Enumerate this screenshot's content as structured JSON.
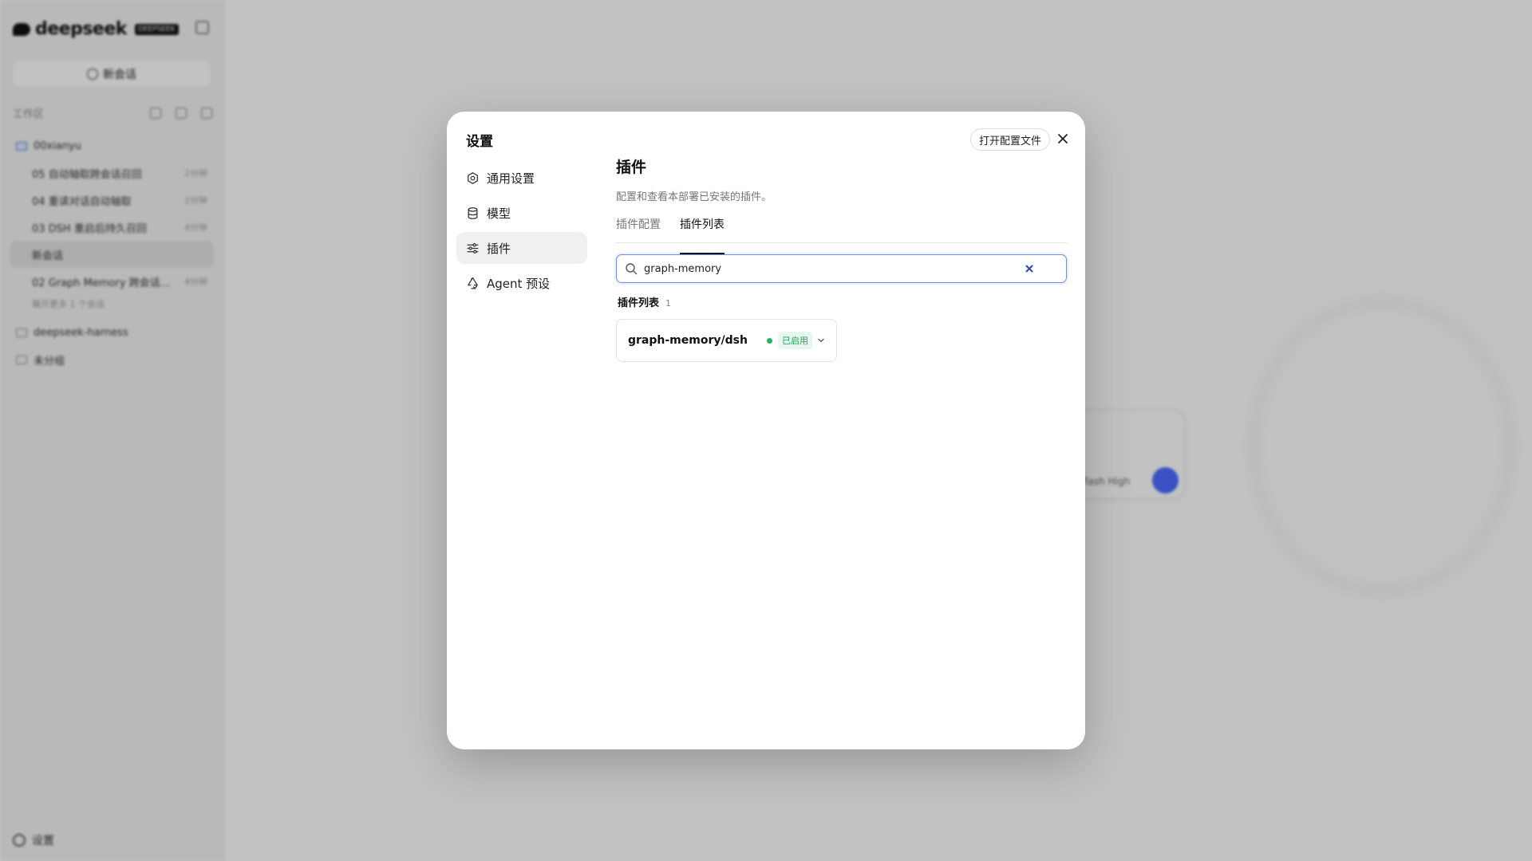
{
  "app": {
    "brand": "deepseek",
    "brand_badge": "DEEPSEEK",
    "new_chat_label": "新会话",
    "workspace_label": "工作区",
    "project": "00xianyu",
    "chats": [
      {
        "title": "05 自动轴取跨会话召回",
        "time": "2分钟"
      },
      {
        "title": "04 重读对话自动轴取",
        "time": "2分钟"
      },
      {
        "title": "03 DSH 重启后持久召回",
        "time": "4分钟"
      },
      {
        "title": "新会话",
        "time": ""
      },
      {
        "title": "02 Graph Memory 跨会话...",
        "time": "4分钟"
      }
    ],
    "chat_sub": "展开更多 1 个会话",
    "groups": [
      "deepseek-harness",
      "未分组"
    ],
    "settings_label": "设置",
    "composer_model": "flash High"
  },
  "modal": {
    "title": "设置",
    "open_config_label": "打开配置文件",
    "close_icon": "close-icon",
    "nav": [
      {
        "label": "通用设置",
        "icon": "gear-icon",
        "active": false
      },
      {
        "label": "模型",
        "icon": "database-icon",
        "active": false
      },
      {
        "label": "插件",
        "icon": "sliders-icon",
        "active": true
      },
      {
        "label": "Agent 预设",
        "icon": "recycle-icon",
        "active": false
      }
    ],
    "section_title": "插件",
    "section_desc": "配置和查看本部署已安装的插件。",
    "tabs": [
      {
        "label": "插件配置",
        "active": false
      },
      {
        "label": "插件列表",
        "active": true
      }
    ],
    "search": {
      "value": "graph-memory",
      "placeholder": ""
    },
    "list_title": "插件列表",
    "list_count": "1",
    "plugins": [
      {
        "name": "graph-memory/dsh",
        "status": "已启用",
        "status_color": "#22b35e"
      }
    ]
  },
  "colors": {
    "accent": "#4d6bfe",
    "enabled": "#22b35e"
  }
}
